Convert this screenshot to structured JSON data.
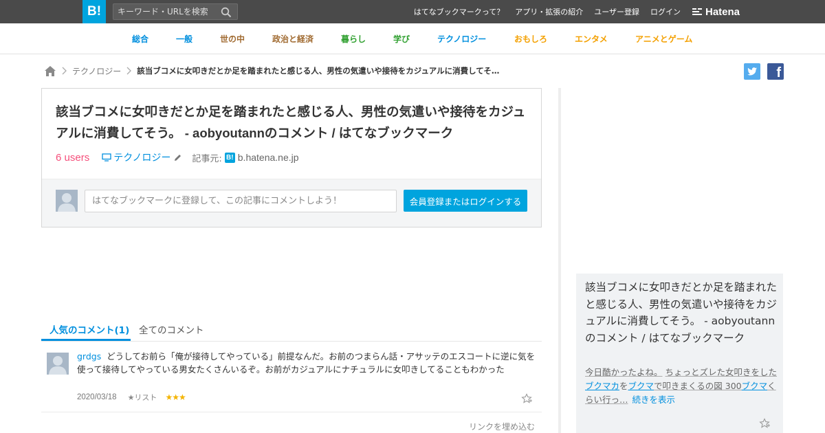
{
  "header": {
    "logo": "B!",
    "search_placeholder": "キーワード・URLを検索",
    "links": [
      "はてなブックマークって？",
      "アプリ・拡張の紹介",
      "ユーザー登録",
      "ログイン"
    ],
    "brand": "Hatena"
  },
  "categories": [
    {
      "label": "総合",
      "color": "#008fde"
    },
    {
      "label": "一般",
      "color": "#008fde"
    },
    {
      "label": "世の中",
      "color": "#a06a30"
    },
    {
      "label": "政治と経済",
      "color": "#a06a30"
    },
    {
      "label": "暮らし",
      "color": "#30a030"
    },
    {
      "label": "学び",
      "color": "#30a030"
    },
    {
      "label": "テクノロジー",
      "color": "#008fde"
    },
    {
      "label": "おもしろ",
      "color": "#f4a000"
    },
    {
      "label": "エンタメ",
      "color": "#f4a000"
    },
    {
      "label": "アニメとゲーム",
      "color": "#f4a000"
    }
  ],
  "breadcrumb": {
    "category": "テクノロジー",
    "current": "該当ブコメに女叩きだとか足を踏まれたと感じる人、男性の気遣いや接待をカジュアルに消費してそ…"
  },
  "entry": {
    "title": "該当ブコメに女叩きだとか足を踏まれたと感じる人、男性の気遣いや接待をカジュアルに消費してそう。 - aobyoutannのコメント / はてなブックマーク",
    "users": "6 users",
    "category": "テクノロジー",
    "source_label": "記事元:",
    "source_icon": "B!",
    "source_domain": "b.hatena.ne.jp"
  },
  "comment_form": {
    "placeholder": "はてなブックマークに登録して、この記事にコメントしよう！",
    "button": "会員登録またはログインする"
  },
  "tabs": {
    "popular": "人気のコメント(1)",
    "all": "全てのコメント"
  },
  "comments": [
    {
      "user": "grdgs",
      "text": "どうしてお前ら「俺が接待してやっている」前提なんだ。お前のつまらん話・アサッテのエスコートに逆に気を使って接待してやっている男女たくさんいるぞ。お前がカジュアルにナチュラルに女叩きしてることもわかった",
      "date": "2020/03/18",
      "list_label": "★リスト",
      "stars": "★★★"
    }
  ],
  "embed_link": "リンクを埋め込む",
  "sidebar": {
    "title": "該当ブコメに女叩きだとか足を踏まれたと感じる人、男性の気遣いや接待をカジュアルに消費してそう。 - aobyoutannのコメント / はてなブックマーク",
    "desc_1": "今日酷かったよね。",
    "desc_2": "ちょっとズレた女叩きをした",
    "desc_3": "ブクマカ",
    "desc_4": "を",
    "desc_5": "ブクマ",
    "desc_6": "で叩きまくるの図 300",
    "desc_7": "ブクマ",
    "desc_8": "くらい行っ…",
    "more": "続きを表示"
  },
  "colors": {
    "brand_blue": "#00a4de",
    "link_blue": "#008fde",
    "users_pink": "#f54f7b",
    "topbar": "#4a4a4a"
  }
}
